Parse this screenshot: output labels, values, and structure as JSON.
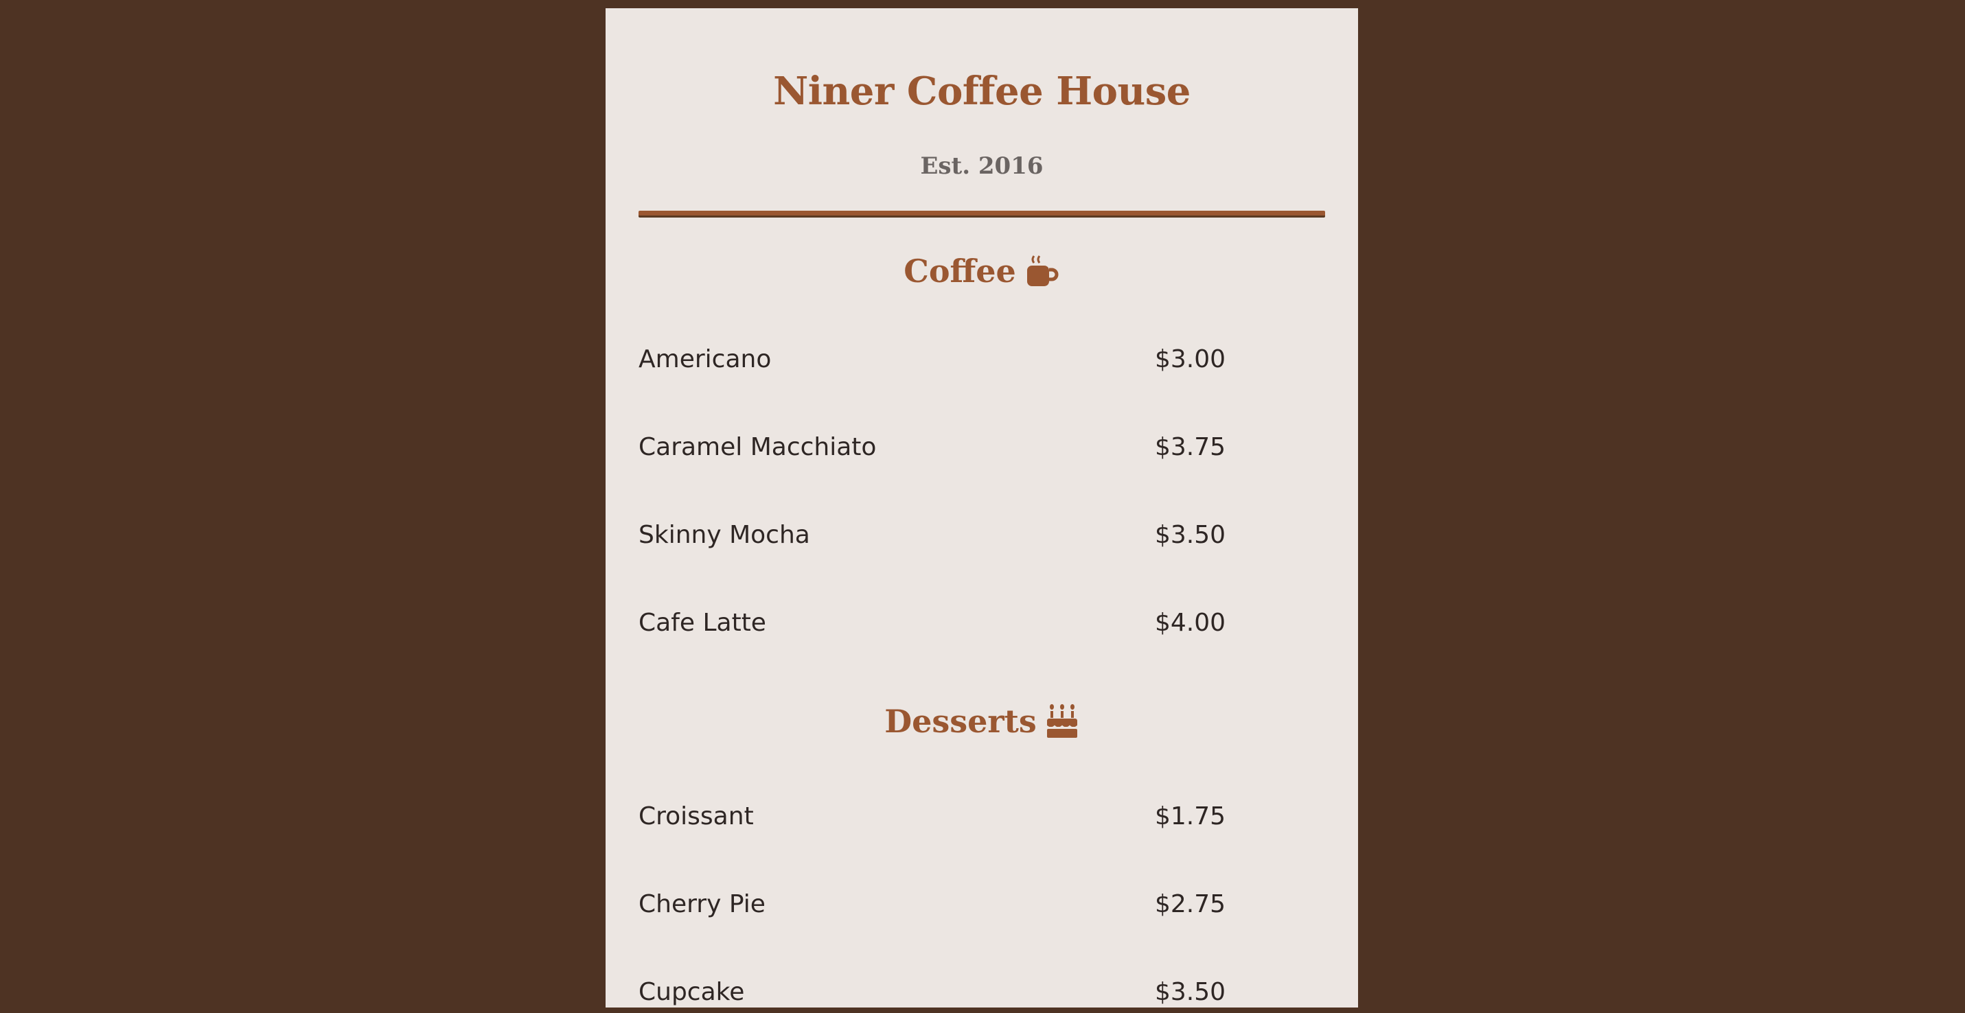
{
  "title": "Niner Coffee House",
  "subtitle": "Est. 2016",
  "colors": {
    "background": "#4e3323",
    "card": "#ece6e2",
    "accent": "#9a5731",
    "text": "#2e2624",
    "muted": "#6a6462"
  },
  "sections": [
    {
      "heading": "Coffee",
      "icon": "coffee-cup-icon",
      "items": [
        {
          "name": "Americano",
          "price": "$3.00"
        },
        {
          "name": "Caramel Macchiato",
          "price": "$3.75"
        },
        {
          "name": "Skinny Mocha",
          "price": "$3.50"
        },
        {
          "name": "Cafe Latte",
          "price": "$4.00"
        }
      ]
    },
    {
      "heading": "Desserts",
      "icon": "birthday-cake-icon",
      "items": [
        {
          "name": "Croissant",
          "price": "$1.75"
        },
        {
          "name": "Cherry Pie",
          "price": "$2.75"
        },
        {
          "name": "Cupcake",
          "price": "$3.50"
        }
      ]
    }
  ]
}
